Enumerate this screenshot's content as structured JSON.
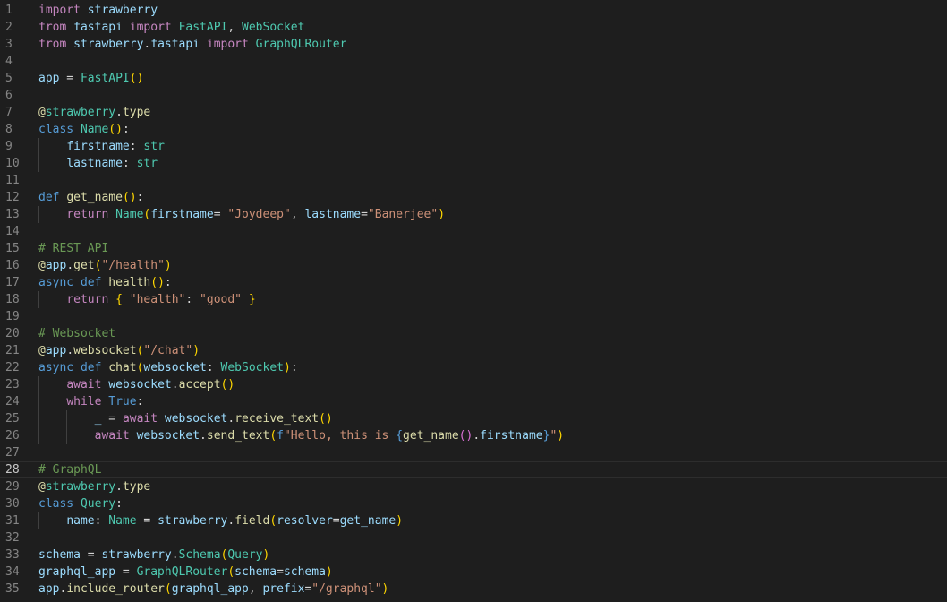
{
  "editor": {
    "current_line": 28,
    "colors": {
      "background": "#1e1e1e",
      "line_number": "#858585",
      "keyword": "#c586c0",
      "storage": "#569cd6",
      "function": "#dcdcaa",
      "class": "#4ec9b0",
      "variable": "#9cdcfe",
      "string": "#ce9178",
      "comment": "#6a9955",
      "bracket_1": "#ffd700",
      "bracket_2": "#da70d6",
      "bracket_3": "#179fff"
    },
    "lines": [
      {
        "n": "1",
        "indent": 0,
        "tokens": [
          [
            "kw",
            "import"
          ],
          [
            "plain",
            " "
          ],
          [
            "var",
            "strawberry"
          ]
        ]
      },
      {
        "n": "2",
        "indent": 0,
        "tokens": [
          [
            "kw",
            "from"
          ],
          [
            "plain",
            " "
          ],
          [
            "var",
            "fastapi"
          ],
          [
            "plain",
            " "
          ],
          [
            "kw",
            "import"
          ],
          [
            "plain",
            " "
          ],
          [
            "cls",
            "FastAPI"
          ],
          [
            "plain",
            ", "
          ],
          [
            "cls",
            "WebSocket"
          ]
        ]
      },
      {
        "n": "3",
        "indent": 0,
        "tokens": [
          [
            "kw",
            "from"
          ],
          [
            "plain",
            " "
          ],
          [
            "var",
            "strawberry"
          ],
          [
            "plain",
            "."
          ],
          [
            "var",
            "fastapi"
          ],
          [
            "plain",
            " "
          ],
          [
            "kw",
            "import"
          ],
          [
            "plain",
            " "
          ],
          [
            "cls",
            "GraphQLRouter"
          ]
        ]
      },
      {
        "n": "4",
        "indent": 0,
        "tokens": []
      },
      {
        "n": "5",
        "indent": 0,
        "tokens": [
          [
            "var",
            "app"
          ],
          [
            "plain",
            " = "
          ],
          [
            "cls",
            "FastAPI"
          ],
          [
            "br1",
            "()"
          ]
        ]
      },
      {
        "n": "6",
        "indent": 0,
        "tokens": []
      },
      {
        "n": "7",
        "indent": 0,
        "tokens": [
          [
            "fn",
            "@"
          ],
          [
            "cls",
            "strawberry"
          ],
          [
            "plain",
            "."
          ],
          [
            "fn",
            "type"
          ]
        ]
      },
      {
        "n": "8",
        "indent": 0,
        "tokens": [
          [
            "def",
            "class"
          ],
          [
            "plain",
            " "
          ],
          [
            "cls",
            "Name"
          ],
          [
            "br1",
            "()"
          ],
          [
            "plain",
            ":"
          ]
        ]
      },
      {
        "n": "9",
        "indent": 1,
        "tokens": [
          [
            "plain",
            "    "
          ],
          [
            "var",
            "firstname"
          ],
          [
            "plain",
            ": "
          ],
          [
            "cls",
            "str"
          ]
        ]
      },
      {
        "n": "10",
        "indent": 1,
        "tokens": [
          [
            "plain",
            "    "
          ],
          [
            "var",
            "lastname"
          ],
          [
            "plain",
            ": "
          ],
          [
            "cls",
            "str"
          ]
        ]
      },
      {
        "n": "11",
        "indent": 0,
        "tokens": []
      },
      {
        "n": "12",
        "indent": 0,
        "tokens": [
          [
            "def",
            "def"
          ],
          [
            "plain",
            " "
          ],
          [
            "fn",
            "get_name"
          ],
          [
            "br1",
            "()"
          ],
          [
            "plain",
            ":"
          ]
        ]
      },
      {
        "n": "13",
        "indent": 1,
        "tokens": [
          [
            "plain",
            "    "
          ],
          [
            "kw",
            "return"
          ],
          [
            "plain",
            " "
          ],
          [
            "cls",
            "Name"
          ],
          [
            "br1",
            "("
          ],
          [
            "var",
            "firstname"
          ],
          [
            "plain",
            "= "
          ],
          [
            "str",
            "\"Joydeep\""
          ],
          [
            "plain",
            ", "
          ],
          [
            "var",
            "lastname"
          ],
          [
            "plain",
            "="
          ],
          [
            "str",
            "\"Banerjee\""
          ],
          [
            "br1",
            ")"
          ]
        ]
      },
      {
        "n": "14",
        "indent": 0,
        "tokens": []
      },
      {
        "n": "15",
        "indent": 0,
        "tokens": [
          [
            "cmt",
            "# REST API"
          ]
        ]
      },
      {
        "n": "16",
        "indent": 0,
        "tokens": [
          [
            "fn",
            "@"
          ],
          [
            "var",
            "app"
          ],
          [
            "plain",
            "."
          ],
          [
            "fn",
            "get"
          ],
          [
            "br1",
            "("
          ],
          [
            "str",
            "\"/health\""
          ],
          [
            "br1",
            ")"
          ]
        ]
      },
      {
        "n": "17",
        "indent": 0,
        "tokens": [
          [
            "def",
            "async"
          ],
          [
            "plain",
            " "
          ],
          [
            "def",
            "def"
          ],
          [
            "plain",
            " "
          ],
          [
            "fn",
            "health"
          ],
          [
            "br1",
            "()"
          ],
          [
            "plain",
            ":"
          ]
        ]
      },
      {
        "n": "18",
        "indent": 1,
        "tokens": [
          [
            "plain",
            "    "
          ],
          [
            "kw",
            "return"
          ],
          [
            "plain",
            " "
          ],
          [
            "br1",
            "{"
          ],
          [
            "plain",
            " "
          ],
          [
            "str",
            "\"health\""
          ],
          [
            "plain",
            ": "
          ],
          [
            "str",
            "\"good\""
          ],
          [
            "plain",
            " "
          ],
          [
            "br1",
            "}"
          ]
        ]
      },
      {
        "n": "19",
        "indent": 0,
        "tokens": []
      },
      {
        "n": "20",
        "indent": 0,
        "tokens": [
          [
            "cmt",
            "# Websocket"
          ]
        ]
      },
      {
        "n": "21",
        "indent": 0,
        "tokens": [
          [
            "fn",
            "@"
          ],
          [
            "var",
            "app"
          ],
          [
            "plain",
            "."
          ],
          [
            "fn",
            "websocket"
          ],
          [
            "br1",
            "("
          ],
          [
            "str",
            "\"/chat\""
          ],
          [
            "br1",
            ")"
          ]
        ]
      },
      {
        "n": "22",
        "indent": 0,
        "tokens": [
          [
            "def",
            "async"
          ],
          [
            "plain",
            " "
          ],
          [
            "def",
            "def"
          ],
          [
            "plain",
            " "
          ],
          [
            "fn",
            "chat"
          ],
          [
            "br1",
            "("
          ],
          [
            "var",
            "websocket"
          ],
          [
            "plain",
            ": "
          ],
          [
            "cls",
            "WebSocket"
          ],
          [
            "br1",
            ")"
          ],
          [
            "plain",
            ":"
          ]
        ]
      },
      {
        "n": "23",
        "indent": 1,
        "tokens": [
          [
            "plain",
            "    "
          ],
          [
            "kw",
            "await"
          ],
          [
            "plain",
            " "
          ],
          [
            "var",
            "websocket"
          ],
          [
            "plain",
            "."
          ],
          [
            "fn",
            "accept"
          ],
          [
            "br1",
            "()"
          ]
        ]
      },
      {
        "n": "24",
        "indent": 1,
        "tokens": [
          [
            "plain",
            "    "
          ],
          [
            "kw",
            "while"
          ],
          [
            "plain",
            " "
          ],
          [
            "def",
            "True"
          ],
          [
            "plain",
            ":"
          ]
        ]
      },
      {
        "n": "25",
        "indent": 2,
        "tokens": [
          [
            "plain",
            "        "
          ],
          [
            "var",
            "_"
          ],
          [
            "plain",
            " = "
          ],
          [
            "kw",
            "await"
          ],
          [
            "plain",
            " "
          ],
          [
            "var",
            "websocket"
          ],
          [
            "plain",
            "."
          ],
          [
            "fn",
            "receive_text"
          ],
          [
            "br1",
            "()"
          ]
        ]
      },
      {
        "n": "26",
        "indent": 2,
        "tokens": [
          [
            "plain",
            "        "
          ],
          [
            "kw",
            "await"
          ],
          [
            "plain",
            " "
          ],
          [
            "var",
            "websocket"
          ],
          [
            "plain",
            "."
          ],
          [
            "fn",
            "send_text"
          ],
          [
            "br1",
            "("
          ],
          [
            "def",
            "f"
          ],
          [
            "str",
            "\"Hello, this is "
          ],
          [
            "def",
            "{"
          ],
          [
            "fn",
            "get_name"
          ],
          [
            "br2",
            "()"
          ],
          [
            "plain",
            "."
          ],
          [
            "var",
            "firstname"
          ],
          [
            "def",
            "}"
          ],
          [
            "str",
            "\""
          ],
          [
            "br1",
            ")"
          ]
        ]
      },
      {
        "n": "27",
        "indent": 0,
        "tokens": []
      },
      {
        "n": "28",
        "indent": 0,
        "tokens": [
          [
            "cmt",
            "# GraphQL"
          ]
        ]
      },
      {
        "n": "29",
        "indent": 0,
        "tokens": [
          [
            "fn",
            "@"
          ],
          [
            "cls",
            "strawberry"
          ],
          [
            "plain",
            "."
          ],
          [
            "fn",
            "type"
          ]
        ]
      },
      {
        "n": "30",
        "indent": 0,
        "tokens": [
          [
            "def",
            "class"
          ],
          [
            "plain",
            " "
          ],
          [
            "cls",
            "Query"
          ],
          [
            "plain",
            ":"
          ]
        ]
      },
      {
        "n": "31",
        "indent": 1,
        "tokens": [
          [
            "plain",
            "    "
          ],
          [
            "var",
            "name"
          ],
          [
            "plain",
            ": "
          ],
          [
            "cls",
            "Name"
          ],
          [
            "plain",
            " = "
          ],
          [
            "var",
            "strawberry"
          ],
          [
            "plain",
            "."
          ],
          [
            "fn",
            "field"
          ],
          [
            "br1",
            "("
          ],
          [
            "var",
            "resolver"
          ],
          [
            "plain",
            "="
          ],
          [
            "var",
            "get_name"
          ],
          [
            "br1",
            ")"
          ]
        ]
      },
      {
        "n": "32",
        "indent": 0,
        "tokens": []
      },
      {
        "n": "33",
        "indent": 0,
        "tokens": [
          [
            "var",
            "schema"
          ],
          [
            "plain",
            " = "
          ],
          [
            "var",
            "strawberry"
          ],
          [
            "plain",
            "."
          ],
          [
            "cls",
            "Schema"
          ],
          [
            "br1",
            "("
          ],
          [
            "cls",
            "Query"
          ],
          [
            "br1",
            ")"
          ]
        ]
      },
      {
        "n": "34",
        "indent": 0,
        "tokens": [
          [
            "var",
            "graphql_app"
          ],
          [
            "plain",
            " = "
          ],
          [
            "cls",
            "GraphQLRouter"
          ],
          [
            "br1",
            "("
          ],
          [
            "var",
            "schema"
          ],
          [
            "plain",
            "="
          ],
          [
            "var",
            "schema"
          ],
          [
            "br1",
            ")"
          ]
        ]
      },
      {
        "n": "35",
        "indent": 0,
        "tokens": [
          [
            "var",
            "app"
          ],
          [
            "plain",
            "."
          ],
          [
            "fn",
            "include_router"
          ],
          [
            "br1",
            "("
          ],
          [
            "var",
            "graphql_app"
          ],
          [
            "plain",
            ", "
          ],
          [
            "var",
            "prefix"
          ],
          [
            "plain",
            "="
          ],
          [
            "str",
            "\"/graphql\""
          ],
          [
            "br1",
            ")"
          ]
        ]
      }
    ]
  }
}
